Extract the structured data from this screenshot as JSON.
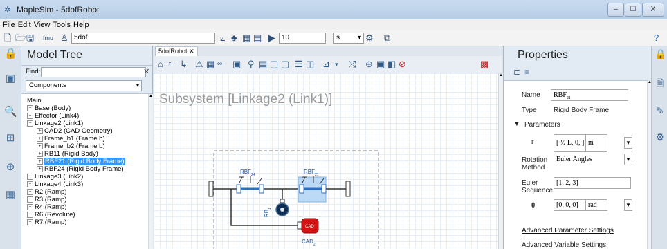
{
  "window": {
    "title": "MapleSim - 5dofRobot",
    "minimize": "–",
    "maximize": "☐",
    "close": "X"
  },
  "menu": [
    "File",
    "Edit",
    "View",
    "Tools",
    "Help"
  ],
  "toolbar": {
    "model_name": "5dof",
    "sim_time": "10",
    "time_unit": "s",
    "help_glyph": "?"
  },
  "tree": {
    "title": "Model Tree",
    "find_label": "Find:",
    "find_value": "",
    "filter_value": "Components",
    "root": "Main",
    "items": [
      {
        "label": "Base (Body)",
        "level": 1,
        "exp": "+"
      },
      {
        "label": "Effector (Link4)",
        "level": 1,
        "exp": "+"
      },
      {
        "label": "Linkage2 (Link1)",
        "level": 1,
        "exp": "−"
      },
      {
        "label": "CAD2 (CAD Geometry)",
        "level": 2,
        "exp": "+"
      },
      {
        "label": "Frame_b1 (Frame b)",
        "level": 2,
        "exp": "+"
      },
      {
        "label": "Frame_b2 (Frame b)",
        "level": 2,
        "exp": "+"
      },
      {
        "label": "RB11 (Rigid Body)",
        "level": 2,
        "exp": "+"
      },
      {
        "label": "RBF21 (Rigid Body Frame)",
        "level": 2,
        "exp": "+",
        "selected": true
      },
      {
        "label": "RBF24 (Rigid Body Frame)",
        "level": 2,
        "exp": "+"
      },
      {
        "label": "Linkage3 (Link2)",
        "level": 1,
        "exp": "+"
      },
      {
        "label": "Linkage4 (Link3)",
        "level": 1,
        "exp": "+"
      },
      {
        "label": "R2 (Ramp)",
        "level": 1,
        "exp": "+"
      },
      {
        "label": "R3 (Ramp)",
        "level": 1,
        "exp": "+"
      },
      {
        "label": "R4 (Ramp)",
        "level": 1,
        "exp": "+"
      },
      {
        "label": "R6 (Revolute)",
        "level": 1,
        "exp": "+"
      },
      {
        "label": "R7 (Ramp)",
        "level": 1,
        "exp": "+"
      }
    ]
  },
  "editor": {
    "tab_label": "5dofRobot",
    "tab_close": "✕",
    "subsystem_title": "Subsystem [Linkage2 (Link1)]",
    "labels": {
      "rbf24": "RBF",
      "rbf24_sub": "24",
      "rbf21": "RBF",
      "rbf21_sub": "21",
      "rb1": "RB",
      "rb1_sub": "1",
      "cad": "CAD",
      "cad2": "CAD",
      "cad2_sub": "2"
    }
  },
  "properties": {
    "title": "Properties",
    "name_label": "Name",
    "name_value": "RBF",
    "name_sub": "21",
    "type_label": "Type",
    "type_value": "Rigid Body Frame",
    "params_header": "Parameters",
    "r_label": "r",
    "r_value": "[ ½ L, 0, ]",
    "r_unit": "m",
    "rotation_label": "Rotation Method",
    "rotation_value": "Euler Angles",
    "euler_label": "Euler Sequence",
    "euler_value": "[1, 2, 3]",
    "theta_label": "θ",
    "theta_value": "[0, 0, 0]",
    "theta_unit": "rad",
    "adv_params": "Advanced Parameter Settings",
    "adv_vars": "Advanced Variable Settings"
  },
  "colors": {
    "selection": "#3399ff",
    "accent": "#2e6fc0",
    "cad_red": "#d41414"
  }
}
